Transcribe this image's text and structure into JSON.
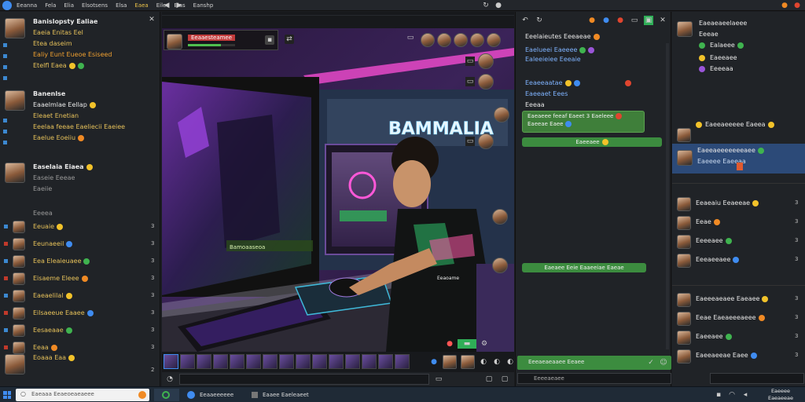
{
  "menu": [
    "Eeanna",
    "Fela",
    "Elia",
    "Elsotsens",
    "Elsa",
    "Eaea",
    "Eile",
    "Eias",
    "Eanshp"
  ],
  "menu_active_index": 5,
  "left_chat": {
    "groups": [
      {
        "name": "Banislopsty Ealiae",
        "lines": [
          "Eaeia Enitas Eel",
          "Etea daseim",
          "Ealiy Eunt Eueoe Esiseed",
          "Etelfl Eaea"
        ]
      },
      {
        "name": "Banenlse",
        "lines": [
          "Eaaelmlae Eellap",
          "Eleaet Enetian",
          "Eeelaa feeae Eaeliecii Eaeiee",
          "Eaelue Eoeiiu"
        ]
      },
      {
        "name": "Easelaia Eiaea",
        "lines": [
          "Easeie Eeeae",
          "Eaeiie"
        ]
      }
    ],
    "users_header": "Eeeea",
    "users": [
      {
        "name": "Eeuaie",
        "badge": "",
        "count": "3"
      },
      {
        "name": "Eeunaeeil",
        "badge": "",
        "count": "3"
      },
      {
        "name": "Eea Eleaieuaee",
        "badge": "",
        "count": "3"
      },
      {
        "name": "Eisaeme Eleee",
        "badge": "",
        "count": "3"
      },
      {
        "name": "Eaeaelilal",
        "badge": "",
        "count": "3"
      },
      {
        "name": "Eilsaeeue Eaaee",
        "badge": "",
        "count": "3"
      },
      {
        "name": "Eesaeaae",
        "badge": "",
        "count": "3"
      },
      {
        "name": "Eeaa",
        "badge": "",
        "count": "3"
      }
    ],
    "bottom_user": "Eoaaa Eaa",
    "bottom_count": "2"
  },
  "stream": {
    "title": "Eeaaesteamee",
    "sign": "BAMMALIA",
    "overlay_label": "Bamoaaseoa",
    "mousepad_label": "Eeaoame"
  },
  "center_chat": {
    "header_label": "Eeelaieutes Eeeaeae",
    "lines": [
      {
        "text": "Eaelueei Eaeeee",
        "color": "b"
      },
      {
        "text": "Ealeeieiee Eeeaie",
        "color": "b"
      },
      {
        "text": "Eeaeeaatae",
        "color": "b"
      },
      {
        "text": "Eaeeaet Eees",
        "color": "b"
      },
      {
        "text": "Eeeaa",
        "color": "w"
      }
    ],
    "bubble_1": "Eaeaeee feeaf Eaeet 3 Eaeleee",
    "bubble_1_sub": "Eaeeae Eaee",
    "bubble_2": "Eaeeaee",
    "bubble_3": "Eaeaee Eeie Eaaeeiae Eaeae",
    "input_placeholder": "Eeeaeaeaaee Eeaee",
    "input2_placeholder": "Eeeeaeaee"
  },
  "right_panel": {
    "top_user": "Eaeaeaeelaeee",
    "top_items": [
      "Eeeae",
      "Ealaeee",
      "Eaeeaee",
      "Eeeeaa"
    ],
    "mid_user": "Eaeeaeeeee Eaeea",
    "selected_user": "Eaeeaeeeeeeeaee",
    "selected_sub": "Eaeeee Eaeeaa",
    "section_1_users": [
      {
        "name": "Eeaeaiu Eeaeeae",
        "count": "3"
      },
      {
        "name": "Eeae",
        "count": "3"
      },
      {
        "name": "Eeeeaee",
        "count": "3"
      },
      {
        "name": "Eeeaeeaee",
        "count": "3"
      }
    ],
    "section_2_users": [
      {
        "name": "Eaeeeaeaee Eaeaee",
        "count": "3"
      },
      {
        "name": "Eeae Eaeaeeeaeee",
        "count": "3"
      },
      {
        "name": "Eaeeaee",
        "count": "3"
      },
      {
        "name": "Eaeeaeeae Eaee",
        "count": "3"
      }
    ]
  },
  "taskbar": {
    "search_placeholder": "Eaeaaa Eeaeoeaeaeee",
    "app_1": "Eeaaeeeeee",
    "app_2": "Eaaee Eaeleaeet",
    "clock_time": "Eaeeee",
    "clock_date": "Eaeaeeae"
  },
  "colors": {
    "accent_green": "#3c8c3f",
    "accent_blue": "#2c4a78",
    "accent_yellow": "#e6c15a"
  }
}
